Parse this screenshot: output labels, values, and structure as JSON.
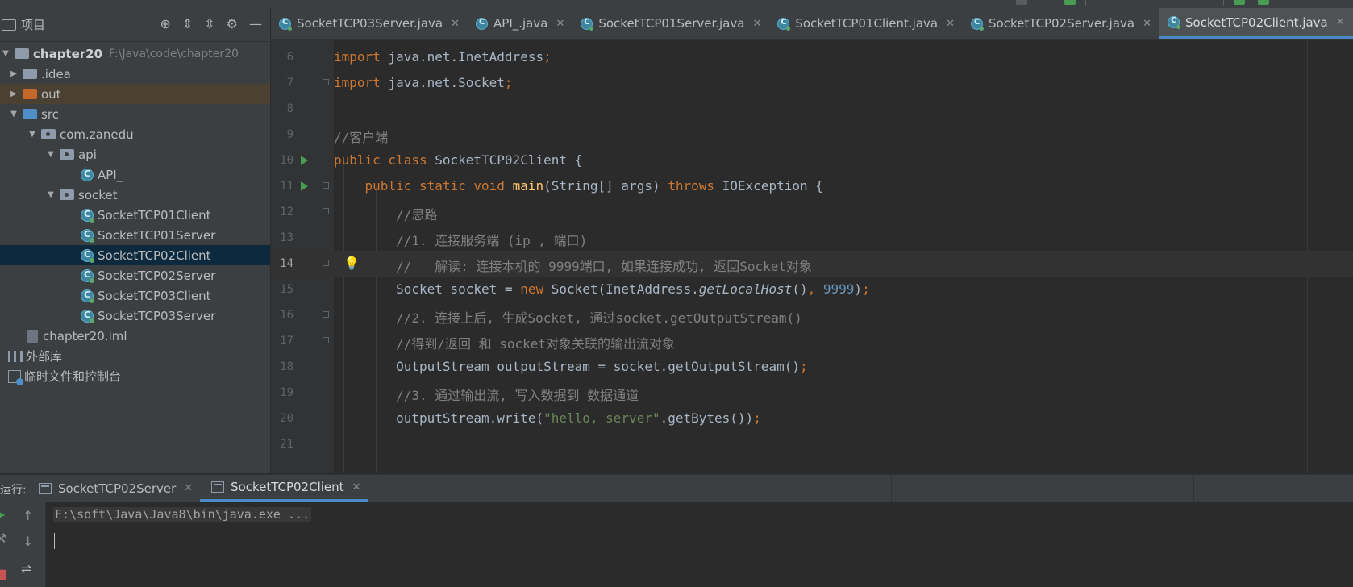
{
  "project": {
    "title": "项目",
    "root_name": "chapter20",
    "root_path": "F:\\Java\\code\\chapter20",
    "items": [
      {
        "label": "chapter20",
        "path": "F:\\Java\\code\\chapter20"
      },
      {
        "label": ".idea"
      },
      {
        "label": "out"
      },
      {
        "label": "src"
      },
      {
        "label": "com.zanedu"
      },
      {
        "label": "api"
      },
      {
        "label": "API_"
      },
      {
        "label": "socket"
      },
      {
        "label": "SocketTCP01Client"
      },
      {
        "label": "SocketTCP01Server"
      },
      {
        "label": "SocketTCP02Client"
      },
      {
        "label": "SocketTCP02Server"
      },
      {
        "label": "SocketTCP03Client"
      },
      {
        "label": "SocketTCP03Server"
      },
      {
        "label": "chapter20.iml"
      },
      {
        "label": "外部库"
      },
      {
        "label": "临时文件和控制台"
      }
    ]
  },
  "tabs": [
    {
      "label": "SocketTCP03Server.java"
    },
    {
      "label": "API_.java"
    },
    {
      "label": "SocketTCP01Server.java"
    },
    {
      "label": "SocketTCP01Client.java"
    },
    {
      "label": "SocketTCP02Server.java"
    },
    {
      "label": "SocketTCP02Client.java"
    }
  ],
  "editor": {
    "current_line": 14,
    "line_numbers": [
      "6",
      "7",
      "8",
      "9",
      "10",
      "11",
      "12",
      "13",
      "14",
      "15",
      "16",
      "17",
      "18",
      "19",
      "20",
      "21"
    ]
  },
  "run": {
    "label": "运行:",
    "tabs": [
      {
        "label": "SocketTCP02Server"
      },
      {
        "label": "SocketTCP02Client"
      }
    ],
    "output_line": "F:\\soft\\Java\\Java8\\bin\\java.exe ..."
  }
}
